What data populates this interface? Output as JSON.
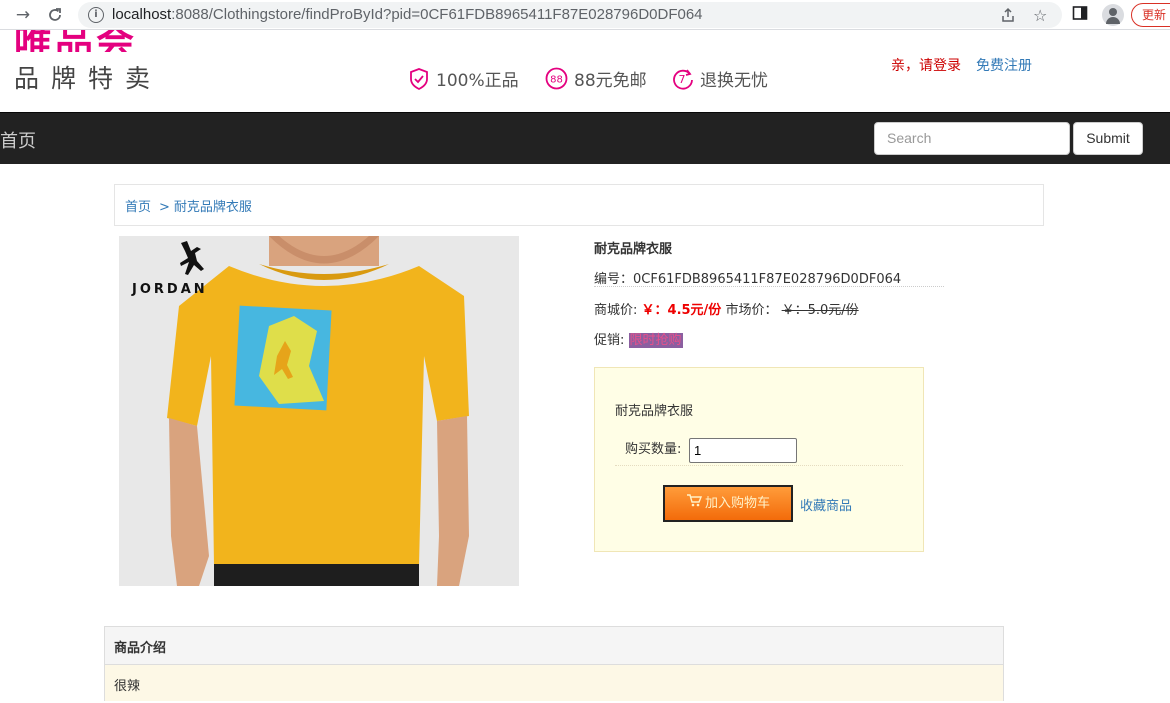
{
  "browser": {
    "url_host": "localhost",
    "url_rest": ":8088/Clothingstore/findProById?pid=0CF61FDB8965411F87E028796D0DF064",
    "update_label": "更新"
  },
  "header": {
    "logo_text": "唯品会",
    "logo_sub": "品牌特卖",
    "promos": [
      {
        "icon": "shield-check-icon",
        "text": "100%正品"
      },
      {
        "icon": "circle-88-icon",
        "text": "88元免邮"
      },
      {
        "icon": "return-7-icon",
        "text": "退换无忧"
      }
    ],
    "login_label": "亲，请登录",
    "register_label": "免费注册"
  },
  "nav": {
    "home_label": "首页",
    "search_placeholder": "Search",
    "submit_label": "Submit"
  },
  "breadcrumb": {
    "home": "首页",
    "separator": ">",
    "current": "耐克品牌衣服"
  },
  "product": {
    "image_alt": "JORDAN yellow t-shirt",
    "brand_text": "JORDAN",
    "title": "耐克品牌衣服",
    "code_label": "编号：",
    "code": "0CF61FDB8965411F87E028796D0DF064",
    "price_label": "商城价:",
    "price": "￥：4.5元/份",
    "market_label": "市场价：",
    "market_price": "￥：5.0元/份",
    "promo_label": "促销:",
    "promo_tag": "限时抢购"
  },
  "buy_box": {
    "name": "耐克品牌衣服",
    "qty_label": "购买数量:",
    "qty_value": "1",
    "cart_label": "加入购物车",
    "fav_label": "收藏商品"
  },
  "intro": {
    "heading": "商品介绍",
    "text": "很辣"
  },
  "colors": {
    "brand_pink": "#e4007f",
    "nav_bg": "#222222",
    "sale_red": "#ee0000",
    "link_blue": "#337ab7",
    "cart_orange": "#f36b0a"
  }
}
